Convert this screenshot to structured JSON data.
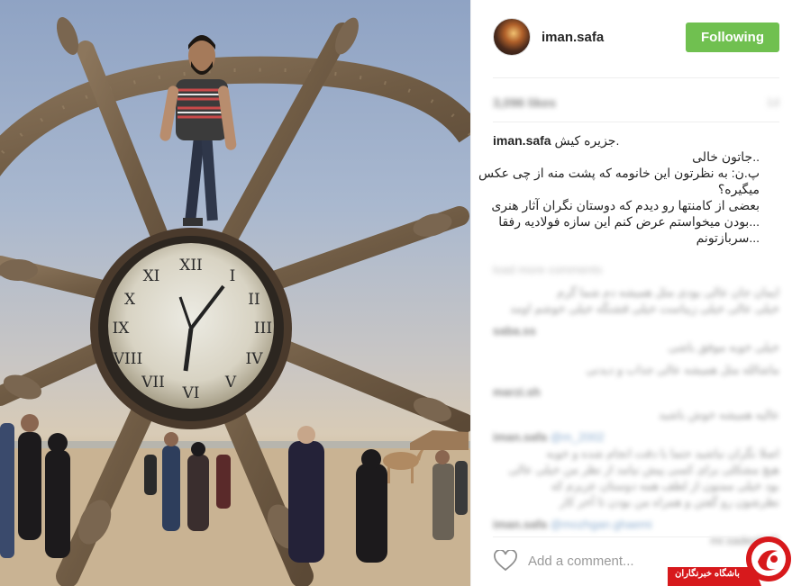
{
  "post": {
    "header": {
      "username": "iman.safa",
      "follow_label": "Following"
    },
    "stats": {
      "likes": "3,096 likes",
      "time": "1d"
    },
    "caption": {
      "username": "iman.safa",
      "lines": [
        ".جزیره کیش",
        "..جاتون خالی",
        "پ.ن: به نظرتون این خانومه که پشت منه از چی عکس",
        "میگیره؟",
        "بعضی از کامنتها رو دیدم که دوستان نگران آثار هنری",
        "...بودن میخواستم عرض کنم این سازه فولادیه رفقا",
        "...سربازتونم"
      ]
    },
    "load_more": "load more comments",
    "comments": [
      {
        "user": "",
        "lines": [
          "ایمان جان عالی بودی مثل همیشه دم شما گرم",
          "خیلی عالی خیلی زیباست خیلی قشنگه خیلی خوشم اومد"
        ]
      },
      {
        "user": "saba.ss",
        "lines": [
          "خیلی خوبه موفق باشی"
        ]
      },
      {
        "user": "",
        "lines": [
          "ماشالله مثل همیشه عالی جذاب و دیدنی"
        ]
      },
      {
        "user": "marzi.sh",
        "lines": []
      },
      {
        "user": "",
        "lines": [
          "عالیه همیشه خوش باشید"
        ]
      },
      {
        "user": "iman.safa",
        "link": "@m_2002",
        "lines": [
          "اصلا نگران نباشید حتما با دقت انجام شده و خوبه",
          "هیچ مشکلی برای کسی پیش نیامد از نظر من خیلی عالی",
          "بود خیلی ممنون از لطف همه دوستان عزیزم که",
          "نظرشون رو گفتن و همراه من بودن تا آخر کار"
        ]
      },
      {
        "user": "iman.safa",
        "link": "@mozhgan.ghaemi",
        "lines": [
          "@mr.sadeghi"
        ]
      }
    ],
    "comment_placeholder": "Add a comment...",
    "watermark": "باشگاه خبرنگاران"
  },
  "colors": {
    "follow_bg": "#70c050",
    "text": "#262626",
    "muted": "#999999",
    "watermark": "#d7191c"
  },
  "icons": {
    "like": "heart-outline-icon",
    "watermark_logo": "yjc-logo-icon"
  }
}
